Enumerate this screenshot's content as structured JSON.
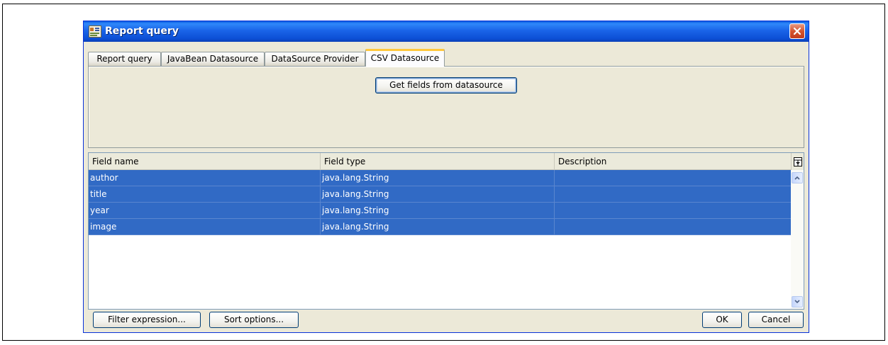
{
  "dialog": {
    "title": "Report query",
    "close_symbol": "✕"
  },
  "tabs": [
    {
      "label": "Report query"
    },
    {
      "label": "JavaBean Datasource"
    },
    {
      "label": "DataSource Provider"
    },
    {
      "label": "CSV Datasource",
      "active": true
    }
  ],
  "panel": {
    "get_fields_label": "Get fields from datasource"
  },
  "table": {
    "columns": [
      "Field name",
      "Field type",
      "Description"
    ],
    "rows": [
      {
        "name": "author",
        "type": "java.lang.String",
        "description": ""
      },
      {
        "name": "title",
        "type": "java.lang.String",
        "description": ""
      },
      {
        "name": "year",
        "type": "java.lang.String",
        "description": ""
      },
      {
        "name": "image",
        "type": "java.lang.String",
        "description": ""
      }
    ],
    "selection_color": "#316ac5"
  },
  "footer": {
    "filter_label": "Filter expression...",
    "sort_label": "Sort options...",
    "ok_label": "OK",
    "cancel_label": "Cancel"
  },
  "icons": {
    "window": "report-query-icon",
    "close": "close-icon",
    "column_chooser": "column-chooser-icon",
    "scroll_up": "scroll-up-icon",
    "scroll_down": "scroll-down-icon"
  }
}
